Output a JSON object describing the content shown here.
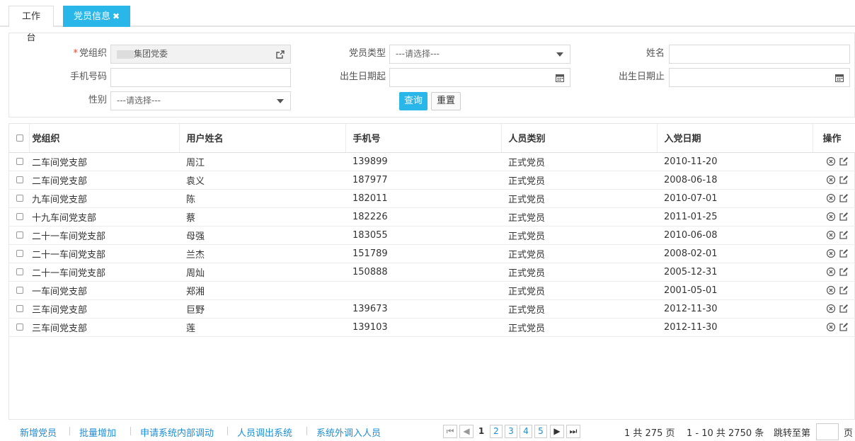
{
  "tabs": {
    "home": "工作台",
    "active": "党员信息",
    "close_glyph": "✖"
  },
  "filters": {
    "org_label": "党组织",
    "org_value": "集团党委",
    "type_label": "党员类型",
    "type_placeholder": "---请选择---",
    "name_label": "姓名",
    "phone_label": "手机号码",
    "birth_from_label": "出生日期起",
    "birth_to_label": "出生日期止",
    "gender_label": "性别",
    "gender_placeholder": "---请选择---",
    "query_button": "查询",
    "reset_button": "重置"
  },
  "table": {
    "columns": [
      "党组织",
      "用户姓名",
      "手机号",
      "人员类别",
      "入党日期",
      "操作"
    ],
    "rows": [
      {
        "org": "二车间党支部",
        "name": "周江",
        "phone": "139899",
        "category": "正式党员",
        "date": "2010-11-20"
      },
      {
        "org": "二车间党支部",
        "name": "袁义",
        "phone": "187977",
        "category": "正式党员",
        "date": "2008-06-18"
      },
      {
        "org": "九车间党支部",
        "name": "陈",
        "phone": "182011",
        "category": "正式党员",
        "date": "2010-07-01"
      },
      {
        "org": "十九车间党支部",
        "name": "蔡",
        "phone": "182226",
        "category": "正式党员",
        "date": "2011-01-25"
      },
      {
        "org": "二十一车间党支部",
        "name": "母强",
        "phone": "183055",
        "category": "正式党员",
        "date": "2010-06-08"
      },
      {
        "org": "二十一车间党支部",
        "name": "兰杰",
        "phone": "151789",
        "category": "正式党员",
        "date": "2008-02-01"
      },
      {
        "org": "二十一车间党支部",
        "name": "周灿",
        "phone": "150888",
        "category": "正式党员",
        "date": "2005-12-31"
      },
      {
        "org": "一车间党支部",
        "name": "郑湘",
        "phone": "",
        "category": "正式党员",
        "date": "2001-05-01"
      },
      {
        "org": "三车间党支部",
        "name": "巨野",
        "phone": "139673",
        "category": "正式党员",
        "date": "2012-11-30"
      },
      {
        "org": "三车间党支部",
        "name": "莲",
        "phone": "139103",
        "category": "正式党员",
        "date": "2012-11-30"
      }
    ]
  },
  "footer": {
    "links": [
      "新增党员",
      "批量增加",
      "申请系统内部调动",
      "人员调出系统",
      "系统外调入人员"
    ],
    "pages": [
      "1",
      "2",
      "3",
      "4",
      "5"
    ],
    "current_page": "1",
    "total_pages_text": "1 共 275 页",
    "range_text": "1 - 10  共 2750 条",
    "jump_label": "跳转至第",
    "page_suffix": "页"
  },
  "colors": {
    "accent": "#29b6e8",
    "link": "#1a8fd8"
  }
}
